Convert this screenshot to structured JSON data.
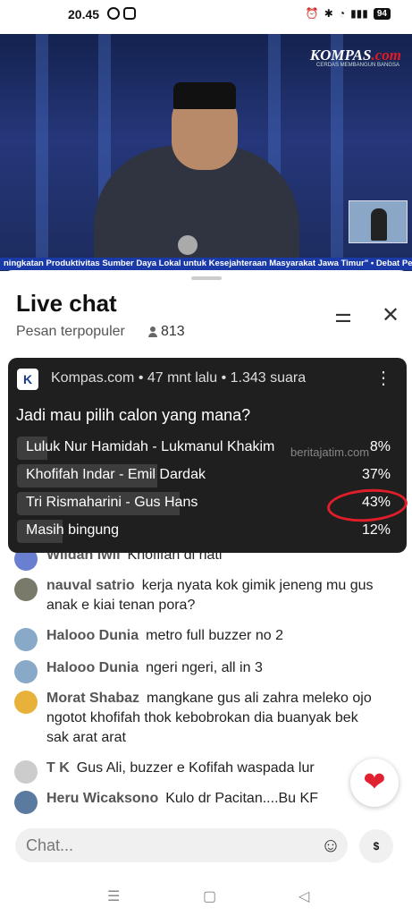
{
  "status": {
    "time": "20.45",
    "battery": "94"
  },
  "video": {
    "logo_main": "KOMPAS",
    "logo_dot": ".com",
    "logo_sub": "CERDAS MEMBANGUN BANGSA",
    "ticker": "ningkatan Produktivitas Sumber Daya Lokal untuk Kesejahteraan Masyarakat Jawa Timur\" • Debat Perdana Ca"
  },
  "chat": {
    "title": "Live chat",
    "subtitle": "Pesan terpopuler",
    "viewers": "813"
  },
  "poll": {
    "channel": "Kompas.com",
    "meta": "Kompas.com • 47 mnt lalu • 1.343 suara",
    "question": "Jadi mau pilih calon yang mana?",
    "options": [
      {
        "label": "Luluk Nur Hamidah - Lukmanul Khakim",
        "pct": "8%",
        "share": 0.08
      },
      {
        "label": "Khofifah Indar - Emil Dardak",
        "pct": "37%",
        "share": 0.37
      },
      {
        "label": "Tri Rismaharini - Gus Hans",
        "pct": "43%",
        "share": 0.43
      },
      {
        "label": "Masih bingung",
        "pct": "12%",
        "share": 0.12
      }
    ],
    "watermark": "beritajatim.com"
  },
  "messages": [
    {
      "author": "Wildan Iwil",
      "text": "Khofifah di hati",
      "color": "#6a7fd0"
    },
    {
      "author": "nauval satrio",
      "text": "kerja nyata kok gimik jeneng mu gus anak e kiai tenan pora?",
      "color": "#7a7a6a"
    },
    {
      "author": "Halooo Dunia",
      "text": "metro full buzzer no 2",
      "color": "#88aac8"
    },
    {
      "author": "Halooo Dunia",
      "text": "ngeri ngeri, all in 3",
      "color": "#88aac8"
    },
    {
      "author": "Morat Shabaz",
      "text": "mangkane gus ali zahra meleko ojo ngotot khofifah thok kebobrokan dia buanyak bek sak arat arat",
      "color": "#e8b23a"
    },
    {
      "author": "T K",
      "text": "Gus Ali, buzzer e Kofifah waspada lur",
      "color": "#cccccc"
    },
    {
      "author": "Heru Wicaksono",
      "text": "Kulo dr Pacitan....Bu KF",
      "color": "#5a7aa0"
    }
  ],
  "composer": {
    "placeholder": "Chat...",
    "super_chat": "$"
  }
}
